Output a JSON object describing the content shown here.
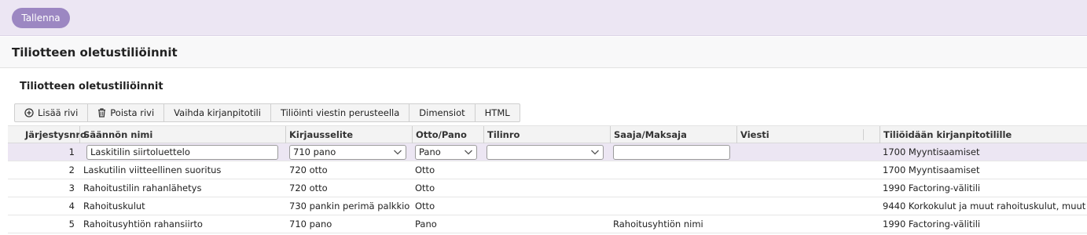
{
  "topbar": {
    "save_label": "Tallenna"
  },
  "header": {
    "title": "Tiliotteen oletustiliöinnit"
  },
  "section": {
    "title": "Tiliotteen oletustiliöinnit"
  },
  "toolbar": {
    "add_row": "Lisää rivi",
    "delete_row": "Poista rivi",
    "change_account": "Vaihda kirjanpitotili",
    "by_message": "Tiliöinti viestin perusteella",
    "dimensions": "Dimensiot",
    "html": "HTML"
  },
  "columns": {
    "order": "Järjestysnro",
    "rule_name": "Säännön nimi",
    "entry_text": "Kirjausselite",
    "out_in": "Otto/Pano",
    "account_no": "Tilinro",
    "payee": "Saaja/Maksaja",
    "message": "Viesti",
    "target_account": "Tiliöidään kirjanpitotilille"
  },
  "rows": [
    {
      "order": "1",
      "rule_name": "Laskitilin siirtoluettelo",
      "entry_text": "710 pano",
      "out_in": "Pano",
      "account_no": "",
      "payee": "",
      "message": "",
      "target_account": "1700 Myyntisaamiset"
    },
    {
      "order": "2",
      "rule_name": "Laskutilin viitteellinen suoritus",
      "entry_text": "720 otto",
      "out_in": "Otto",
      "account_no": "",
      "payee": "",
      "message": "",
      "target_account": "1700 Myyntisaamiset"
    },
    {
      "order": "3",
      "rule_name": "Rahoitustilin rahanlähetys",
      "entry_text": "720 otto",
      "out_in": "Otto",
      "account_no": "",
      "payee": "",
      "message": "",
      "target_account": "1990 Factoring-välitili"
    },
    {
      "order": "4",
      "rule_name": "Rahoituskulut",
      "entry_text": "730 pankin perimä palkkio",
      "out_in": "Otto",
      "account_no": "",
      "payee": "",
      "message": "",
      "target_account": "9440 Korkokulut ja muut rahoituskulut, muut"
    },
    {
      "order": "5",
      "rule_name": "Rahoitusyhtiön rahansiirto",
      "entry_text": "710 pano",
      "out_in": "Pano",
      "account_no": "",
      "payee": "Rahoitusyhtiön nimi",
      "message": "",
      "target_account": "1990 Factoring-välitili"
    }
  ],
  "colors": {
    "accent": "#9c87c2",
    "selected_row": "#ece6f3"
  }
}
